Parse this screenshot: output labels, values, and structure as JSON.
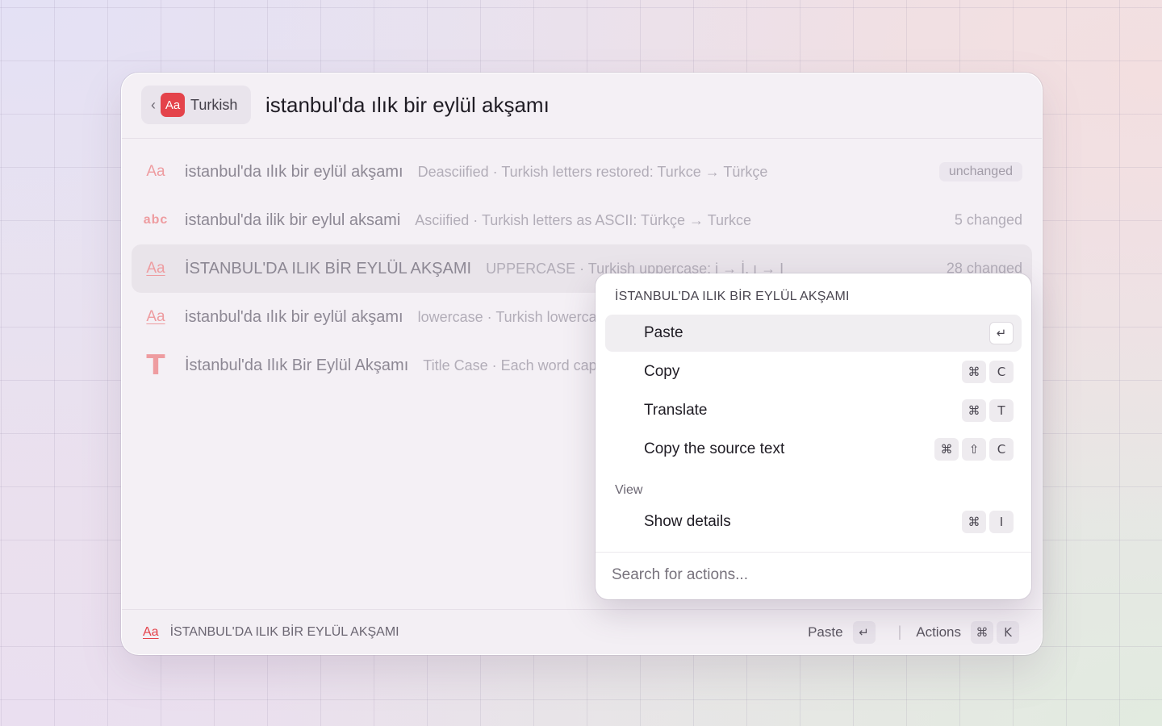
{
  "header": {
    "back_chevron": "‹",
    "badge_text": "Aa",
    "back_label": "Turkish",
    "query": "istanbul'da ılık bir eylül akşamı"
  },
  "rows": [
    {
      "icon": "Aa",
      "title": "istanbul'da ılık bir eylül akşamı",
      "subtitle": "Deasciified · Turkish letters restored: Turkce → Türkçe",
      "meta": "unchanged"
    },
    {
      "icon": "abc",
      "title": "istanbul'da ilik bir eylul aksami",
      "subtitle": "Asciified · Turkish letters as ASCII: Türkçe → Turkce",
      "meta": "5 changed"
    },
    {
      "icon": "Aa",
      "title": "İSTANBUL'DA ILIK BİR EYLÜL AKŞAMI",
      "subtitle": "UPPERCASE · Turkish uppercase: i → İ, ı → I",
      "meta": "28 changed"
    },
    {
      "icon": "Aa",
      "title": "istanbul'da ılık bir eylül akşamı",
      "subtitle": "lowercase · Turkish lowercase",
      "meta": ""
    },
    {
      "icon": "T",
      "title": "İstanbul'da Ilık Bir Eylül Akşamı",
      "subtitle": "Title Case · Each word capitalized",
      "meta": ""
    }
  ],
  "footer": {
    "icon": "Aa",
    "title": "İSTANBUL'DA ILIK BİR EYLÜL AKŞAMI",
    "primary_label": "Paste",
    "primary_key": "↵",
    "separator": "|",
    "actions_label": "Actions",
    "actions_keys": [
      "⌘",
      "K"
    ]
  },
  "menu": {
    "title": "İSTANBUL'DA ILIK BİR EYLÜL AKŞAMI",
    "items": [
      {
        "label": "Paste",
        "keys": [
          "↵"
        ]
      },
      {
        "label": "Copy",
        "keys": [
          "⌘",
          "C"
        ]
      },
      {
        "label": "Translate",
        "keys": [
          "⌘",
          "T"
        ]
      },
      {
        "label": "Copy the source text",
        "keys": [
          "⌘",
          "⇧",
          "C"
        ]
      }
    ],
    "section_label": "View",
    "view_items": [
      {
        "label": "Show details",
        "keys": [
          "⌘",
          "I"
        ]
      }
    ],
    "search_placeholder": "Search for actions..."
  },
  "colors": {
    "accent": "#e4434b",
    "icon_muted": "#ee9ca0"
  }
}
